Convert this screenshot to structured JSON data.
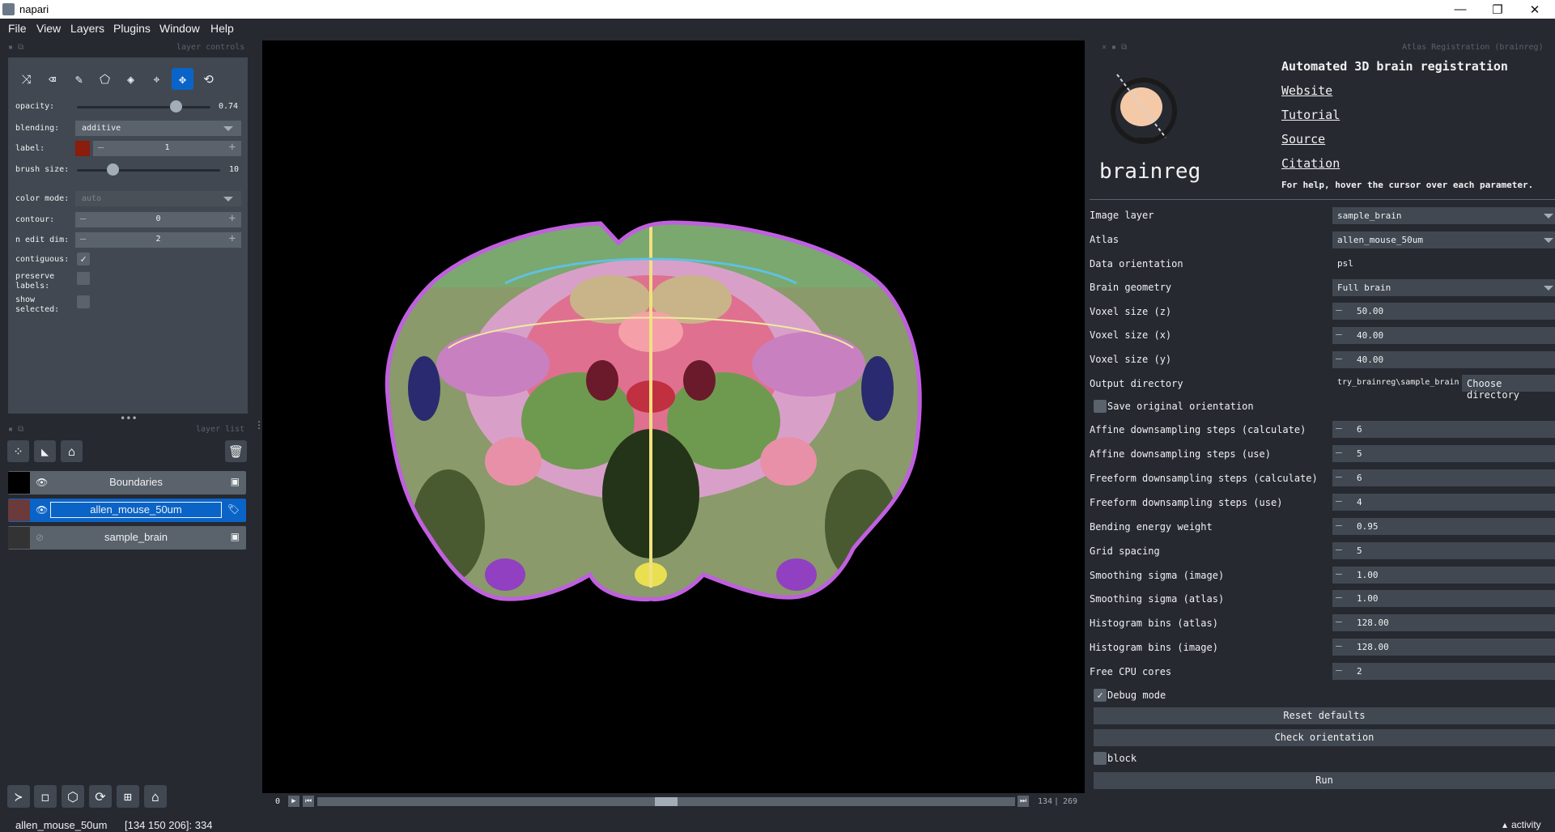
{
  "window": {
    "title": "napari",
    "controls": {
      "minimize": "—",
      "maximize": "❐",
      "close": "✕"
    }
  },
  "menu": [
    "File",
    "View",
    "Layers",
    "Plugins",
    "Window",
    "Help"
  ],
  "layer_controls": {
    "panel_title": "layer controls",
    "tools": [
      "shuffle-icon",
      "eraser-icon",
      "brush-icon",
      "polygon-icon",
      "fill-icon",
      "picker-icon",
      "pan-zoom-icon",
      "transform-icon"
    ],
    "active_tool": "pan-zoom-icon",
    "opacity_label": "opacity:",
    "opacity_value": "0.74",
    "opacity": 0.74,
    "blending_label": "blending:",
    "blending_value": "additive",
    "label_label": "label:",
    "label_value": "1",
    "label_color": "#8b1c0e",
    "brush_label": "brush size:",
    "brush_value": "10",
    "brush_fraction": 0.25,
    "color_mode_label": "color mode:",
    "color_mode_value": "auto",
    "contour_label": "contour:",
    "contour_value": "0",
    "edit_dim_label": "n edit dim:",
    "edit_dim_value": "2",
    "contiguous_label": "contiguous:",
    "preserve_label_1": "preserve",
    "preserve_label_2": "labels:",
    "show_selected_1": "show",
    "show_selected_2": "selected:"
  },
  "layer_list": {
    "panel_title": "layer list",
    "layers": [
      {
        "name": "Boundaries",
        "visible": true,
        "type_icon": "image-icon"
      },
      {
        "name": "allen_mouse_50um",
        "visible": true,
        "type_icon": "labels-icon"
      },
      {
        "name": "sample_brain",
        "visible": false,
        "type_icon": "image-icon"
      }
    ]
  },
  "dims": {
    "index_label": "0",
    "position": "134",
    "total": "269",
    "fraction": 0.5
  },
  "status": {
    "layer": "allen_mouse_50um",
    "coords": "[134 150 206]: 334",
    "activity": "activity"
  },
  "plugin": {
    "panel_title": "Atlas Registration (brainreg)",
    "heading": "Automated 3D brain registration",
    "logo_text": "brainreg",
    "links": [
      "Website",
      "Tutorial",
      "Source",
      "Citation"
    ],
    "help": "For help, hover the cursor over each parameter.",
    "params": [
      {
        "label": "Image layer",
        "kind": "combo",
        "value": "sample_brain"
      },
      {
        "label": "Atlas",
        "kind": "combo",
        "value": "allen_mouse_50um"
      },
      {
        "label": "Data orientation",
        "kind": "text",
        "value": "psl"
      },
      {
        "label": "Brain geometry",
        "kind": "combo",
        "value": "Full brain"
      },
      {
        "label": "Voxel size (z)",
        "kind": "spin",
        "value": "50.00"
      },
      {
        "label": "Voxel size (x)",
        "kind": "spin",
        "value": "40.00"
      },
      {
        "label": "Voxel size (y)",
        "kind": "spin",
        "value": "40.00"
      },
      {
        "label": "Output directory",
        "kind": "dir",
        "value": "try_brainreg\\sample_brain",
        "button": "Choose directory"
      }
    ],
    "save_orientation": "Save original orientation",
    "params2": [
      {
        "label": "Affine downsampling steps (calculate)",
        "value": "6"
      },
      {
        "label": "Affine downsampling steps (use)",
        "value": "5"
      },
      {
        "label": "Freeform downsampling steps (calculate)",
        "value": "6"
      },
      {
        "label": "Freeform downsampling steps (use)",
        "value": "4"
      },
      {
        "label": "Bending energy weight",
        "value": "0.95"
      },
      {
        "label": "Grid spacing",
        "value": "5"
      },
      {
        "label": "Smoothing sigma (image)",
        "value": "1.00"
      },
      {
        "label": "Smoothing sigma (atlas)",
        "value": "1.00"
      },
      {
        "label": "Histogram bins (atlas)",
        "value": "128.00"
      },
      {
        "label": "Histogram bins (image)",
        "value": "128.00"
      },
      {
        "label": "Free CPU cores",
        "value": "2"
      }
    ],
    "debug_mode": "Debug mode",
    "reset_defaults": "Reset defaults",
    "check_orientation": "Check orientation",
    "block": "block",
    "run": "Run"
  }
}
